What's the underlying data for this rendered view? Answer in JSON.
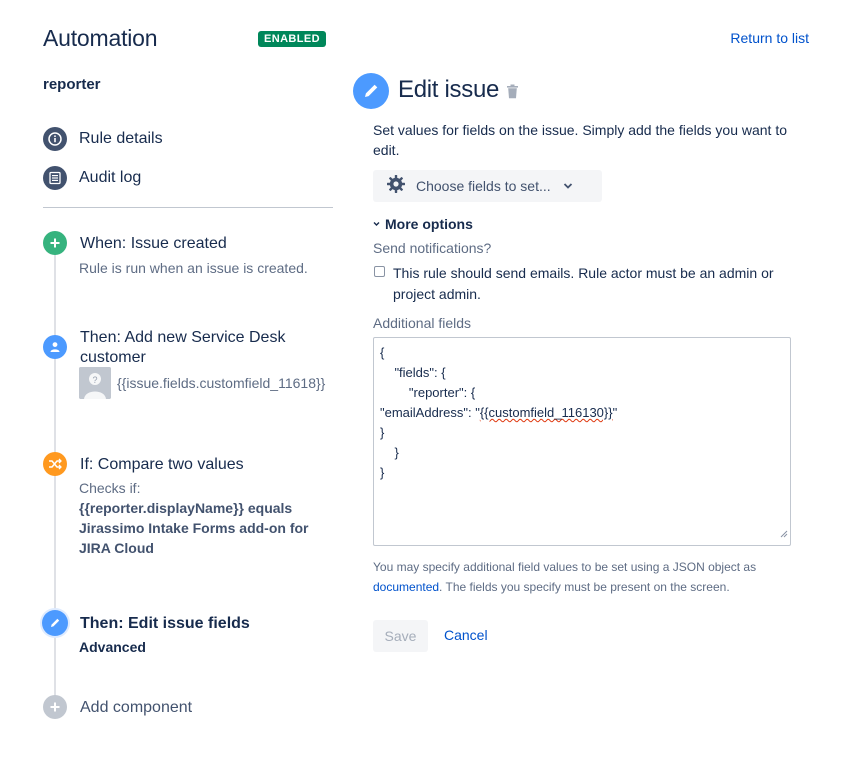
{
  "header": {
    "app_title": "Automation",
    "status_badge": "ENABLED",
    "return_link": "Return to list"
  },
  "sidebar": {
    "rule_name": "reporter",
    "nav": [
      {
        "label": "Rule details",
        "icon": "info-icon"
      },
      {
        "label": "Audit log",
        "icon": "list-icon"
      }
    ],
    "components": {
      "trigger": {
        "title": "When: Issue created",
        "desc": "Rule is run when an issue is created.",
        "icon": "plus-icon",
        "color": "#36b37e"
      },
      "action1": {
        "title_line1": "Then: Add new Service Desk",
        "title_line2": "customer",
        "value": "{{issue.fields.customfield_11618}}",
        "icon": "person-icon",
        "color": "#4c9aff"
      },
      "condition": {
        "title": "If: Compare two values",
        "desc": "Checks if:",
        "expr_line1": "{{reporter.displayName}} equals",
        "expr_line2": "Jirassimo Intake Forms add-on for",
        "expr_line3": "JIRA Cloud",
        "icon": "shuffle-icon",
        "color": "#ff991f"
      },
      "action2": {
        "title": "Then: Edit issue fields",
        "subtitle": "Advanced",
        "icon": "pencil-icon",
        "color": "#4c9aff"
      },
      "add": {
        "label": "Add component",
        "icon": "plus-icon",
        "color": "#c1c7d0"
      }
    }
  },
  "main": {
    "title": "Edit issue",
    "description": "Set values for fields on the issue. Simply add the fields you want to edit.",
    "choose_fields": "Choose fields to set...",
    "more_options": "More options",
    "send_notifications_label": "Send notifications?",
    "send_emails_text": "This rule should send emails. Rule actor must be an admin or project admin.",
    "additional_fields_label": "Additional fields",
    "json_lines": {
      "l1": "{",
      "l2": "    \"fields\": {",
      "l3": "        \"reporter\": {",
      "l4a": "\"emailAddress\": \"",
      "l4b": "{{customfield_116130}}",
      "l4c": "\"",
      "l5": "}",
      "l6": "    }",
      "l7": "}"
    },
    "help_prefix": "You may specify additional field values to be set using a JSON object as ",
    "help_link": "documented",
    "help_suffix": ". The fields you specify must be present on the screen.",
    "save_label": "Save",
    "cancel_label": "Cancel"
  },
  "colors": {
    "accent_blue": "#0052cc",
    "enabled_green": "#00875a",
    "text_primary": "#172b4d",
    "text_subtle": "#5e6c84"
  }
}
